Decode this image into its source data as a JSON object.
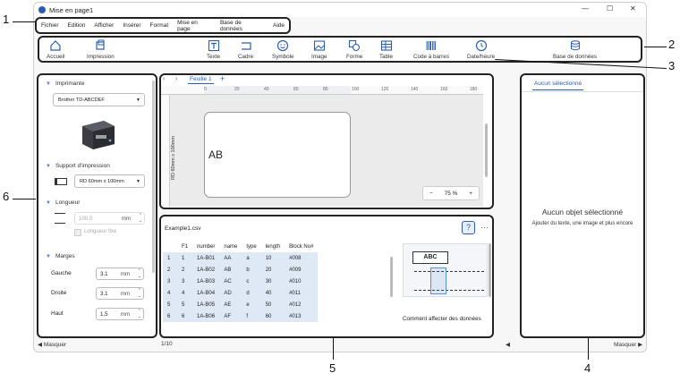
{
  "window": {
    "title": "Mise en page1"
  },
  "menu": [
    "Fichier",
    "Edition",
    "Afficher",
    "Insérer",
    "Format",
    "Mise en page",
    "Base de données",
    "Aide"
  ],
  "ribbon": {
    "items": [
      {
        "label": "Accueil",
        "icon": "home-icon"
      },
      {
        "label": "Impression",
        "icon": "print-icon"
      },
      {
        "label": "Texte",
        "icon": "text-icon"
      },
      {
        "label": "Cadre",
        "icon": "frame-icon"
      },
      {
        "label": "Symbole",
        "icon": "symbol-icon"
      },
      {
        "label": "Image",
        "icon": "image-icon"
      },
      {
        "label": "Forme",
        "icon": "shape-icon"
      },
      {
        "label": "Table",
        "icon": "table-icon"
      },
      {
        "label": "Code à barres",
        "icon": "barcode-icon"
      },
      {
        "label": "Date/heure",
        "icon": "clock-icon"
      },
      {
        "label": "Base de données",
        "icon": "database-icon"
      }
    ]
  },
  "left": {
    "printer": {
      "title": "Imprimante",
      "model": "Brother TD-ABCDEF"
    },
    "media": {
      "title": "Support d'impression",
      "value": "RD 60mm x 100mm"
    },
    "length": {
      "title": "Longueur",
      "value": "100.0",
      "unit": "mm",
      "checkbox": "Longueur fixe"
    },
    "margins": {
      "title": "Marges",
      "rows": [
        {
          "label": "Gauche",
          "value": "3.1",
          "unit": "mm"
        },
        {
          "label": "Droite",
          "value": "3.1",
          "unit": "mm"
        },
        {
          "label": "Haut",
          "value": "1.5",
          "unit": "mm"
        }
      ]
    },
    "hide": "Masquer"
  },
  "canvas": {
    "tab": "Feuille 1",
    "ruler": [
      "0",
      "20",
      "40",
      "60",
      "80",
      "100",
      "120",
      "140",
      "160",
      "180"
    ],
    "vruler": "RD 60mm x 100mm",
    "label_text": "AB",
    "zoom": "75 %"
  },
  "db": {
    "file": "Example1.csv",
    "columns": [
      "F1",
      "number",
      "name",
      "type",
      "length",
      "Block No#"
    ],
    "rows": [
      [
        "1",
        "1",
        "1A-B01",
        "AA",
        "a",
        "10",
        "#008"
      ],
      [
        "2",
        "2",
        "1A-B02",
        "AB",
        "b",
        "20",
        "#009"
      ],
      [
        "3",
        "3",
        "1A-B03",
        "AC",
        "c",
        "30",
        "#010"
      ],
      [
        "4",
        "4",
        "1A-B04",
        "AD",
        "d",
        "40",
        "#011"
      ],
      [
        "5",
        "5",
        "1A-B05",
        "AE",
        "e",
        "50",
        "#012"
      ],
      [
        "6",
        "6",
        "1A-B06",
        "AF",
        "f",
        "60",
        "#013"
      ]
    ],
    "help_title": "Comment affecter des données",
    "help_sample": "ABC",
    "page": "1/10"
  },
  "props": {
    "tab": "Aucun sélectionné",
    "empty_title": "Aucun objet sélectionné",
    "empty_hint": "Ajouter du texte, une image et plus encore",
    "hide": "Masquer"
  },
  "callouts": [
    "1",
    "2",
    "3",
    "4",
    "5",
    "6"
  ],
  "colors": {
    "accent": "#2a5db0",
    "selected_row": "#dfe9f6"
  }
}
